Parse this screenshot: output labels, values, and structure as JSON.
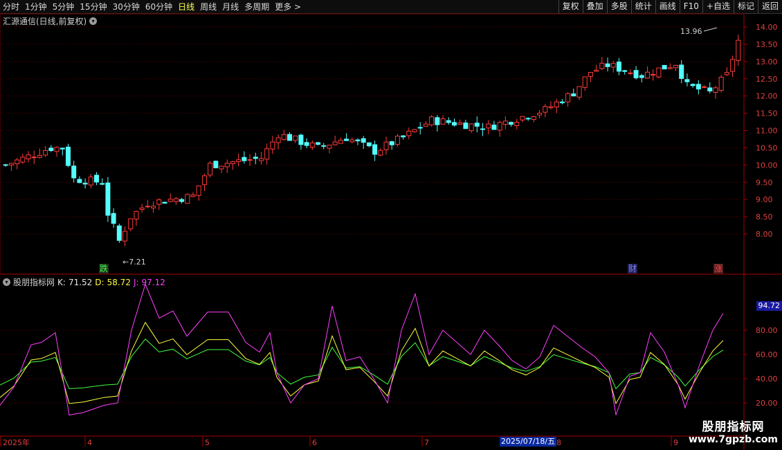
{
  "toolbar": {
    "periods": [
      "分时",
      "1分钟",
      "5分钟",
      "15分钟",
      "30分钟",
      "60分钟",
      "日线",
      "周线",
      "月线",
      "多周期",
      "更多 >"
    ],
    "active_period": "日线",
    "buttons": [
      "复权",
      "叠加",
      "多股",
      "统计",
      "画线",
      "F10",
      "+自选",
      "标记",
      "返回"
    ]
  },
  "stock": {
    "title": "汇源通信(日线,前复权)",
    "max_label": "13.96",
    "min_label": "7.21",
    "markers": {
      "fall": "跌",
      "finance": "财",
      "rise": "涨"
    }
  },
  "price_axis": [
    "14.00",
    "13.50",
    "13.00",
    "12.50",
    "12.00",
    "11.50",
    "11.00",
    "10.50",
    "10.00",
    "9.50",
    "9.00",
    "8.50",
    "8.00"
  ],
  "indicator": {
    "name": "股朋指标网",
    "k_label": "K:",
    "k_value": "71.52",
    "d_label": "D:",
    "d_value": "58.72",
    "j_label": "J:",
    "j_value": "97.12",
    "right_value": "94.72",
    "axis": [
      "80.00",
      "60.00",
      "40.00",
      "20.00"
    ]
  },
  "date_axis": {
    "labels": [
      "2025年",
      "4",
      "5",
      "6",
      "7",
      "8",
      "9"
    ],
    "tooltip": "2025/07/18/五"
  },
  "watermark": {
    "line1": "股朋指标网",
    "line2": "www.7gpzb.com"
  },
  "colors": {
    "up": "#ff3b3b",
    "down": "#54ffff",
    "k": "#e8e8e8",
    "d": "#ffff40",
    "j": "#ff40ff",
    "dline": "#40ff40",
    "grid": "#6a0000"
  }
}
